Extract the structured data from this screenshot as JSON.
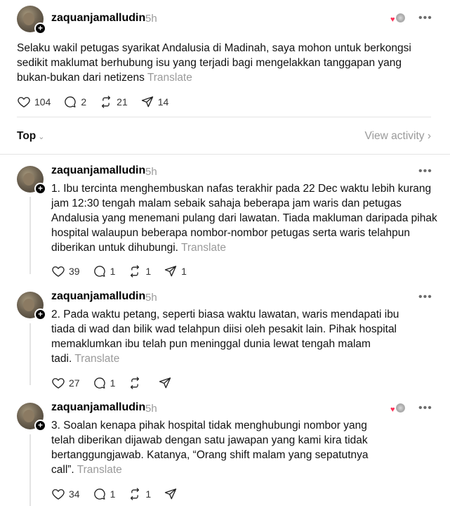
{
  "main_post": {
    "username": "zaquanjamalludin",
    "time": "5h",
    "lines": [
      "Selaku wakil petugas syarikat Andalusia di Madinah, saya mohon untuk berkongsi",
      "sedikit maklumat berhubung isu yang terjadi bagi mengelakkan tanggapan yang",
      "bukan-bukan dari netizens"
    ],
    "translate": "Translate",
    "likes": "104",
    "replies": "2",
    "reposts": "21",
    "shares": "14"
  },
  "replies_header": {
    "sort_label": "Top",
    "view_activity": "View activity"
  },
  "replies": [
    {
      "username": "zaquanjamalludin",
      "time": "5h",
      "lines": [
        "1. Ibu tercinta menghembuskan nafas terakhir pada 22 Dec waktu lebih kurang",
        "jam 12:30 tengah malam sebaik sahaja beberapa jam waris dan petugas",
        "Andalusia yang menemani pulang dari lawatan. Tiada makluman daripada pihak",
        "hospital walaupun beberapa nombor-nombor petugas serta waris telahpun",
        "diberikan untuk dihubungi."
      ],
      "translate": "Translate",
      "likes": "39",
      "replies": "1",
      "reposts": "1",
      "shares": "1"
    },
    {
      "username": "zaquanjamalludin",
      "time": "5h",
      "lines": [
        "2. Pada waktu petang, seperti biasa waktu lawatan, waris mendapati ibu",
        "tiada di wad dan bilik wad telahpun diisi oleh pesakit lain. Pihak hospital",
        "memaklumkan ibu telah pun meninggal dunia lewat tengah malam",
        "tadi."
      ],
      "translate": "Translate",
      "likes": "27",
      "replies": "1",
      "reposts": "",
      "shares": ""
    },
    {
      "username": "zaquanjamalludin",
      "time": "5h",
      "lines": [
        "3. Soalan kenapa pihak hospital tidak menghubungi nombor yang",
        "telah diberikan dijawab dengan satu jawapan yang kami kira tidak",
        "bertanggungjawab. Katanya, “Orang shift malam yang sepatutnya",
        "call”."
      ],
      "translate": "Translate",
      "likes": "34",
      "replies": "1",
      "reposts": "1",
      "shares": ""
    }
  ],
  "colors": {
    "heart_red": "#ff2d55",
    "muted": "#9a9a9a",
    "divider": "#e4e4e4"
  }
}
